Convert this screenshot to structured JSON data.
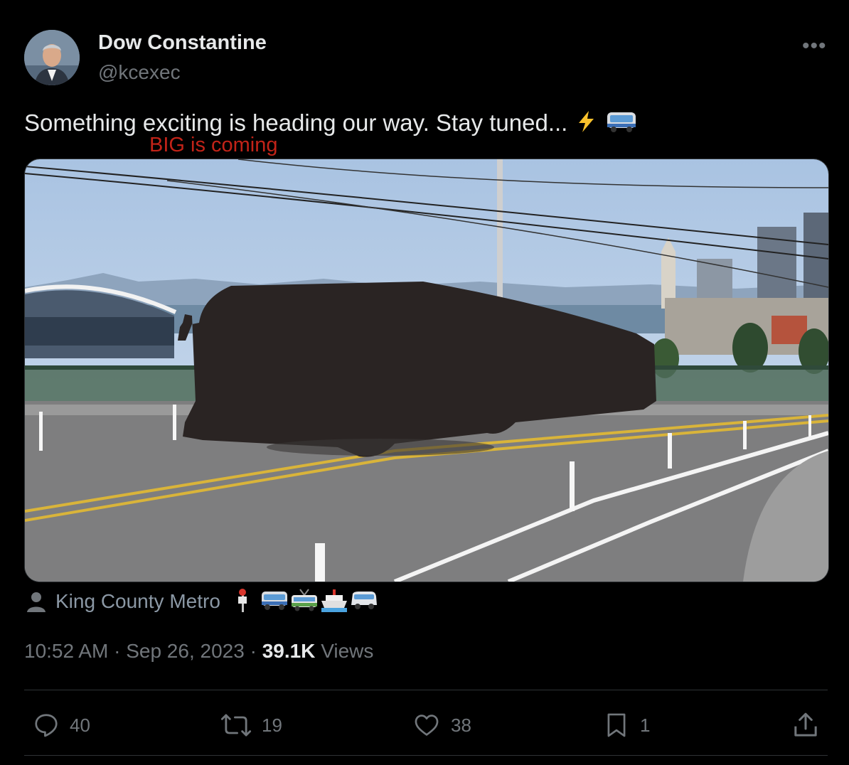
{
  "author": {
    "name": "Dow Constantine",
    "handle": "@kcexec",
    "avatar_icon": "avatar"
  },
  "more_icon": "more-options-icon",
  "tweet": {
    "text": "Something exciting is heading our way. Stay tuned...",
    "emojis": [
      "high-voltage-emoji",
      "bus-emoji"
    ],
    "overlay_text": "BIG is coming"
  },
  "media": {
    "description_icon": "photo"
  },
  "tagged": {
    "label": "King County Metro",
    "emojis": [
      "bus-stop-emoji",
      "bus-emoji",
      "trolleybus-emoji",
      "ferry-emoji",
      "minibus-emoji"
    ]
  },
  "meta": {
    "time": "10:52 AM",
    "separator": "·",
    "date": "Sep 26, 2023",
    "views_count": "39.1K",
    "views_label": "Views"
  },
  "actions": {
    "replies": "40",
    "retweets": "19",
    "likes": "38",
    "bookmarks": "1"
  },
  "colors": {
    "background": "#000000",
    "primary_text": "#e7e9ea",
    "secondary_text": "#71767b",
    "overlay_red": "#c22318"
  }
}
